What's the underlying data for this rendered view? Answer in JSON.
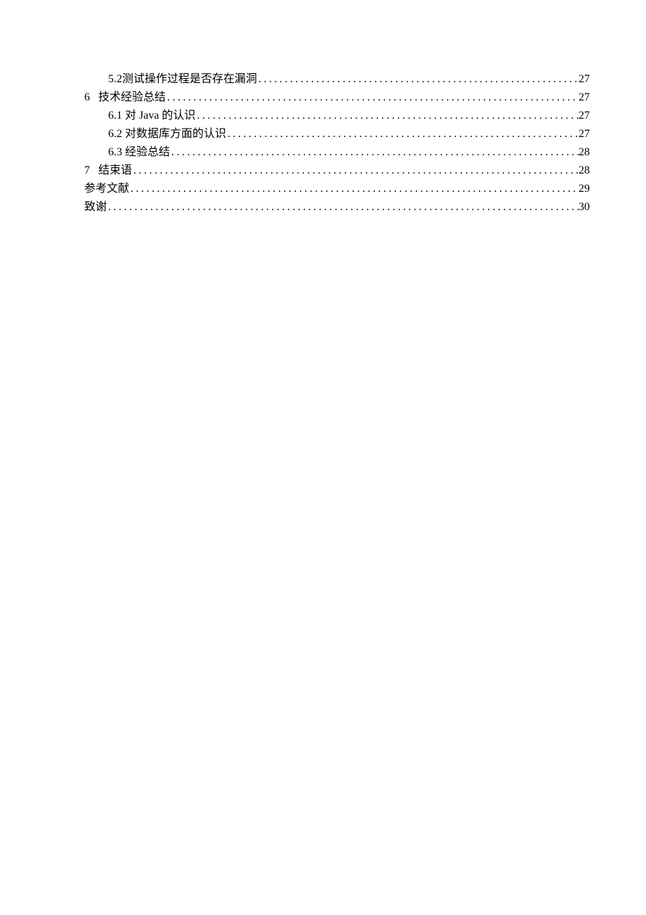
{
  "toc": [
    {
      "level": 2,
      "number": "5.2",
      "title": "测试操作过程是否存在漏洞",
      "page": "27"
    },
    {
      "level": 1,
      "number": "6",
      "title": "技术经验总结",
      "page": "27"
    },
    {
      "level": 2,
      "number": "6.1",
      "title": "对 Java 的认识",
      "page": "27"
    },
    {
      "level": 2,
      "number": "6.2",
      "title": "对数据库方面的认识",
      "page": "27"
    },
    {
      "level": 2,
      "number": "6.3",
      "title": "经验总结",
      "page": "28"
    },
    {
      "level": 1,
      "number": "7",
      "title": "结束语",
      "page": "28"
    },
    {
      "level": 0,
      "number": "",
      "title": "参考文献",
      "page": "29"
    },
    {
      "level": 0,
      "number": "",
      "title": "致谢",
      "page": "30"
    }
  ]
}
